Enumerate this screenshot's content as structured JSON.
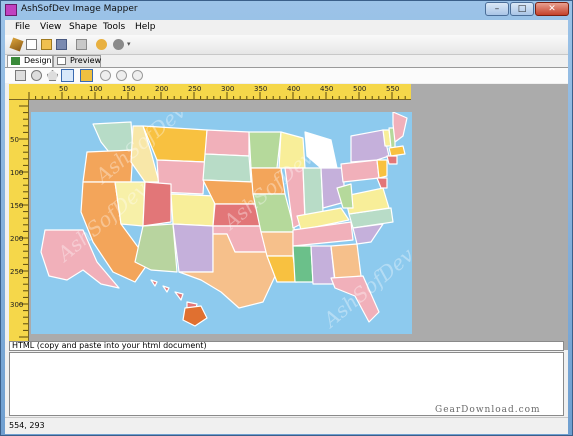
{
  "window": {
    "title": "AshSofDev Image Mapper",
    "buttons": {
      "minimize": "–",
      "maximize": "□",
      "close": "✕"
    }
  },
  "menu": {
    "items": [
      "File",
      "View",
      "Shape",
      "Tools",
      "Help"
    ]
  },
  "toolbar": {
    "icons": [
      "wand-icon",
      "new-icon",
      "open-icon",
      "save-icon",
      "copy-icon",
      "export-icon",
      "help-icon"
    ]
  },
  "tabs": [
    {
      "label": "Design",
      "active": true
    },
    {
      "label": "Preview",
      "active": false
    }
  ],
  "shape_tools": [
    "rectangle-tool-icon",
    "circle-tool-icon",
    "polygon-tool-icon",
    "pointer-tool-icon",
    "crop-tool-icon",
    "zoom-in-icon",
    "zoom-out-icon",
    "zoom-reset-icon"
  ],
  "ruler": {
    "horizontal": [
      "50",
      "100",
      "150",
      "200",
      "250",
      "300",
      "350",
      "400",
      "450",
      "500",
      "550"
    ],
    "vertical": [
      "50",
      "100",
      "150",
      "200",
      "250",
      "300"
    ]
  },
  "canvas": {
    "image": "united-states-map",
    "watermark": "AshSofDev"
  },
  "html_panel": {
    "label": "HTML (copy and paste into your html document)",
    "content": ""
  },
  "status": {
    "coordinates": "554, 293"
  },
  "overlay_watermark": "GearDownload.com"
}
